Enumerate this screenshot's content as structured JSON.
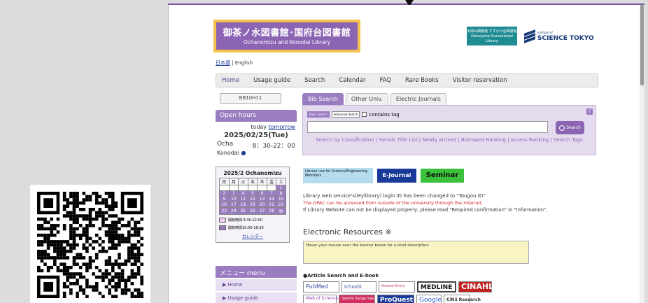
{
  "library": {
    "name_jp": "御茶ノ水図書館･国府台図書館",
    "name_en": "Ochanomizu and Konodai Library",
    "partner_teal": "大岡山図書館 すずかけ台図書館 Ookayama Suzukakedai Library",
    "partner_name": "SCIENCE TOKYO",
    "partner_small": "Institute of"
  },
  "lang": {
    "jp": "日本語",
    "sep": " | ",
    "en": "English"
  },
  "nav": [
    "Home",
    "Usage guide",
    "Search",
    "Calendar",
    "FAQ",
    "Rare Books",
    "Visitor reservation"
  ],
  "sidebar": {
    "search_button": "BB10H11",
    "open_hours_title": "Open hours",
    "today_label": "today",
    "tomorrow_label": "tomorrow",
    "date": "2025/02/25(Tue)",
    "ocha_label": "Ocha",
    "ocha_hours": "8：30-22：00",
    "konodai_label": "Konodai",
    "konodai_mark": "●",
    "calendar_title": "2025/2 Ochanomizu",
    "weekdays": [
      "日",
      "月",
      "火",
      "水",
      "木",
      "金",
      "土"
    ],
    "legend1": "開館時間 8:30-22:00",
    "legend2": "開館時間10:00-18:30",
    "calendar_link": "カレンダー",
    "menu_title": "メニュー menu",
    "menu_items": [
      "Home",
      "Usage guide"
    ]
  },
  "search": {
    "tabs": [
      "Bib Search",
      "Other Univ.",
      "Electric Journals"
    ],
    "basic": "Basic Search",
    "advanced": "Advanced Search",
    "contains_tag": "contains tag",
    "button": "Search",
    "help": "?",
    "links": "Search by Classification | Serials Title List | Newly Arrived | Borrowed Ranking | Access Ranking | Search Tags"
  },
  "banners": {
    "library_use": "Library use for Science/Engineering Members",
    "ejournal": "E-Journal",
    "seminar": "Seminar"
  },
  "notices": {
    "n1": "Library web service's(Mylibrary) login ID has been changed to \"Tougou ID\"",
    "n2": "The OPAC can be accessed from outside of the University through the internet.",
    "n3": "If Library Website can not be displayed properly, please read \"Required confirmation\" in \"Information\"."
  },
  "eresources": {
    "title": "Electronic Resources ※",
    "hover_text": "Hover your mouse over the banner below for a brief description",
    "article_title": "●Article Search and E-book",
    "logos": [
      "PubMed",
      "Ichushi",
      "Medical*Online",
      "MEDLINE",
      "CINAHL",
      "Web of Science",
      "Saishin Kango Sakuin Web",
      "ProQuest",
      "Google",
      "CiNii Research"
    ]
  },
  "calendar_cells": [
    [
      "",
      "",
      "",
      "",
      "",
      "",
      "1"
    ],
    [
      "2",
      "3",
      "4",
      "5",
      "6",
      "7",
      "8"
    ],
    [
      "9",
      "10",
      "11",
      "12",
      "13",
      "14",
      "15"
    ],
    [
      "16",
      "17",
      "18",
      "19",
      "20",
      "21",
      "22"
    ],
    [
      "23",
      "24",
      "25",
      "26",
      "27",
      "28",
      "休"
    ]
  ]
}
